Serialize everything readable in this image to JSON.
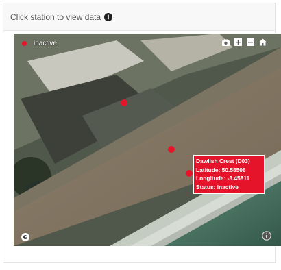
{
  "header": {
    "text": "Click station to view data",
    "info_icon": "info-circle-icon"
  },
  "legend": {
    "label": "inactive",
    "color": "#e5142b"
  },
  "toolbar": {
    "icons": [
      "camera-icon",
      "zoom-in-icon",
      "zoom-out-icon",
      "home-icon"
    ]
  },
  "stations": [
    {
      "status": "inactive"
    },
    {
      "status": "inactive"
    },
    {
      "status": "inactive"
    }
  ],
  "tooltip": {
    "name": "Dawlish Crest (D03)",
    "latitude": "Latitude: 50.58508",
    "longitude": "Longitude: -3.45811",
    "status": "Status: inactive",
    "background": "#e5142b"
  },
  "corner_icons": {
    "bottom_left": "mapbox-logo-icon",
    "bottom_right": "info-icon"
  },
  "colors": {
    "marker": "#e5142b",
    "header_text": "#555555"
  }
}
